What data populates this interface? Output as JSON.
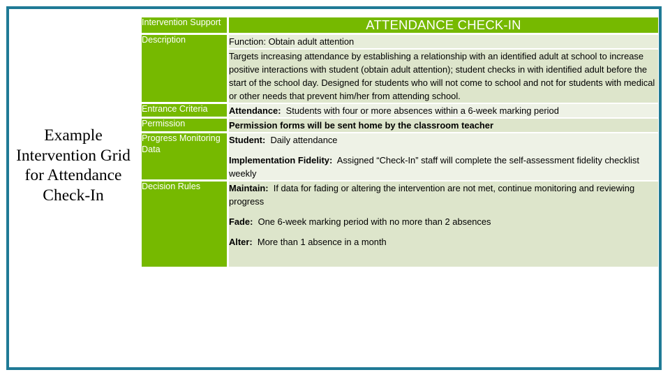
{
  "slide": {
    "left_title": "Example Intervention Grid for Attendance Check-In",
    "frame_color": "#1f7a96",
    "accent_green": "#76b900"
  },
  "table": {
    "header": {
      "label": "Intervention Support",
      "title": "ATTENDANCE CHECK-IN"
    },
    "rows": [
      {
        "label": "",
        "label_rowspan_note": "Description label spans function + description rows",
        "content_function": "Function: Obtain adult attention"
      },
      {
        "label": "Description",
        "content": "Targets increasing attendance by establishing a relationship with an identified adult at school to increase positive interactions with student (obtain adult attention); student checks in with identified adult before the start of the school day. Designed for students who will not come to school and not for students with medical or other needs that prevent him/her from attending school."
      },
      {
        "label": "Entrance Criteria",
        "lead": "Attendance:",
        "content": "Students with four or more absences within a 6-week marking period"
      },
      {
        "label": "Permission",
        "content": "Permission forms will be sent home by the classroom teacher"
      },
      {
        "label": "Progress Monitoring Data",
        "lines": [
          {
            "lead": "Student:",
            "text": "Daily attendance"
          },
          {
            "lead": "Implementation Fidelity:",
            "text": "Assigned “Check-In” staff will complete the self-assessment fidelity checklist weekly"
          }
        ]
      },
      {
        "label": "Decision Rules",
        "lines": [
          {
            "lead": "Maintain:",
            "text": "If data for fading or altering the intervention are not met, continue monitoring and reviewing progress"
          },
          {
            "lead": "Fade:",
            "text": "One 6-week marking period with no more than 2 absences"
          },
          {
            "lead": "Alter:",
            "text": "More than 1 absence in a month"
          }
        ]
      }
    ]
  }
}
